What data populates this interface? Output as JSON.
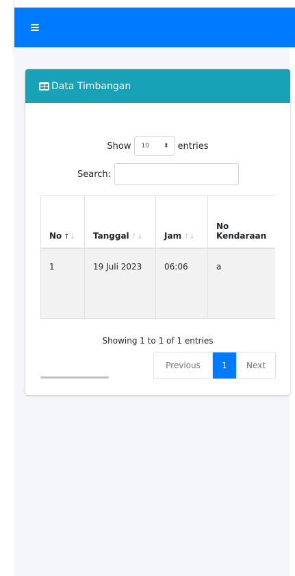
{
  "navbar": {
    "menu_icon": "bars-icon",
    "color": "#007bff"
  },
  "card": {
    "title": "Data Timbangan",
    "header_icon": "table-icon",
    "header_color": "#17a2b8"
  },
  "datatable": {
    "show_label": "Show",
    "length_value": "10",
    "entries_label": "entries",
    "search_label": "Search:",
    "search_value": "",
    "columns": [
      "No",
      "Tanggal",
      "Jam",
      "No Kendaraan"
    ],
    "rows": [
      {
        "no": "1",
        "tanggal": "19 Juli 2023",
        "jam": "06:06",
        "no_kendaraan": "a"
      }
    ],
    "info": "Showing 1 to 1 of 1 entries",
    "pagination": {
      "previous": "Previous",
      "current": "1",
      "next": "Next"
    }
  }
}
